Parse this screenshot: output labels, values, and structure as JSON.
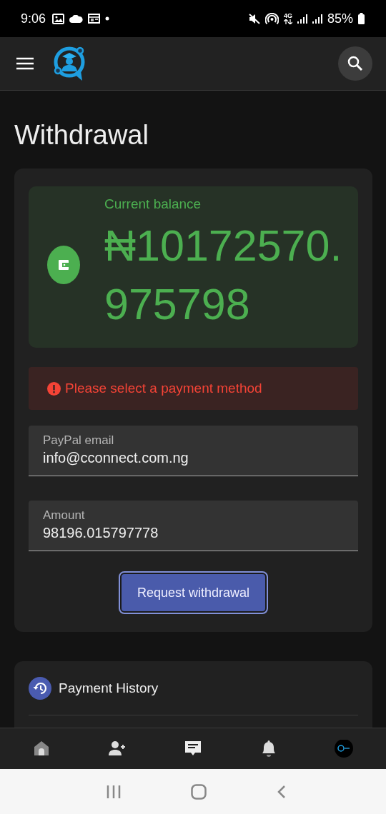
{
  "status_bar": {
    "time": "9:06",
    "network": "4G",
    "battery": "85%"
  },
  "page_title": "Withdrawal",
  "balance": {
    "label": "Current balance",
    "amount": "₦10172570.975798"
  },
  "alert": {
    "message": "Please select a payment method"
  },
  "fields": [
    {
      "label": "PayPal email",
      "value": "info@cconnect.com.ng"
    },
    {
      "label": "Amount",
      "value": "98196.015797778"
    }
  ],
  "submit_button": "Request withdrawal",
  "history": {
    "title": "Payment History"
  },
  "bottom_nav": [
    {
      "kind": "home"
    },
    {
      "kind": "add-user"
    },
    {
      "kind": "messages"
    },
    {
      "kind": "notifications"
    },
    {
      "kind": "profile"
    }
  ]
}
